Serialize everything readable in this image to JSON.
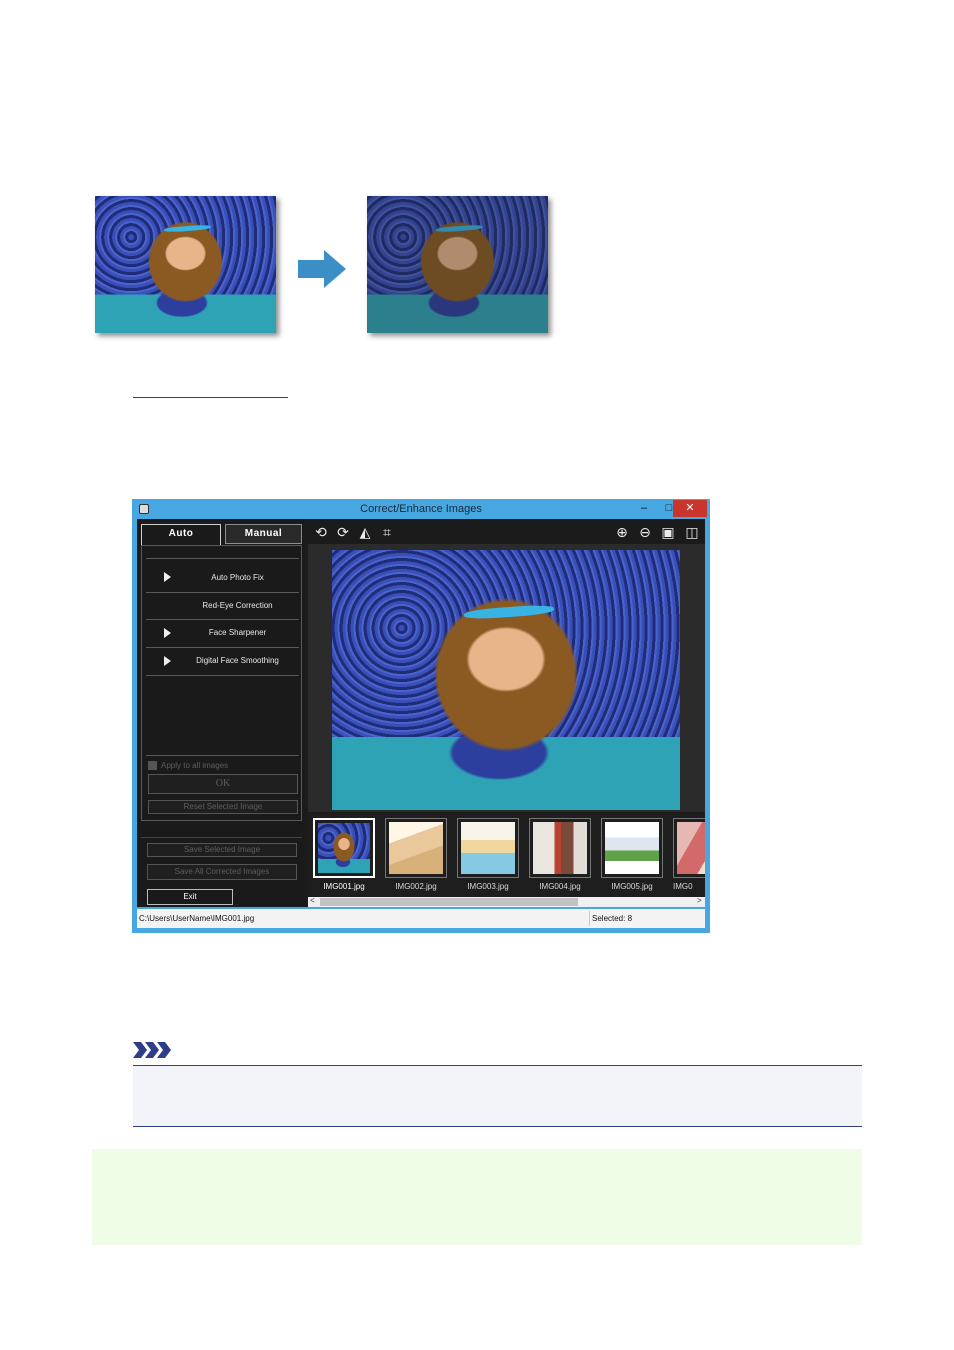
{
  "window": {
    "title": "Correct/Enhance Images",
    "min_glyph": "–",
    "max_glyph": "□",
    "close_glyph": "✕"
  },
  "tabs": {
    "auto": "Auto",
    "manual": "Manual"
  },
  "auto_panel": {
    "fixes": [
      "Auto Photo Fix",
      "Red-Eye Correction",
      "Face Sharpener",
      "Digital Face Smoothing"
    ],
    "apply_all": "Apply to all images",
    "ok": "OK",
    "reset": "Reset Selected Image",
    "save_selected": "Save Selected Image",
    "save_all": "Save All Corrected Images",
    "exit": "Exit"
  },
  "toolbar": {
    "left_icons": [
      "rotate-left-icon",
      "rotate-right-icon",
      "flip-icon",
      "crop-icon"
    ],
    "right_icons": [
      "zoom-in-icon",
      "zoom-out-icon",
      "full-screen-icon",
      "compare-icon"
    ],
    "glyphs": {
      "rotate_left": "⟲",
      "rotate_right": "⟳",
      "flip": "◭",
      "crop": "⌗",
      "zoom_in": "⊕",
      "zoom_out": "⊖",
      "full": "▣",
      "compare": "◫"
    }
  },
  "thumbnails": [
    "IMG001.jpg",
    "IMG002.jpg",
    "IMG003.jpg",
    "IMG004.jpg",
    "IMG005.jpg",
    "IMG0"
  ],
  "status": {
    "path": "C:\\Users\\UserName\\IMG001.jpg",
    "selected": "Selected: 8"
  },
  "scroll": {
    "left": "<",
    "right": ">"
  },
  "colors": {
    "window_frame": "#47a7e0",
    "close_button": "#c7352d",
    "note_rule": "#2e3e8a",
    "arrow": "#3b8fc6"
  }
}
